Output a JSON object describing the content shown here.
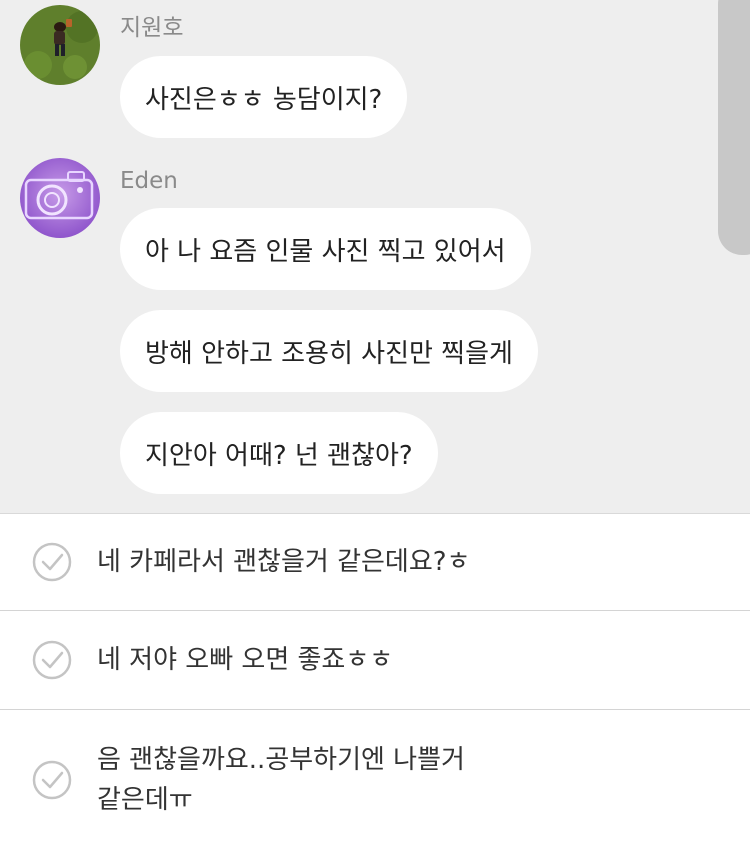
{
  "colors": {
    "chat_background": "#eeeeee",
    "bubble": "#ffffff",
    "sender_name": "#8a8a8a",
    "message_text": "#222222",
    "option_text": "#333333",
    "check_icon": "#c4c4c4",
    "scrollbar": "#c8c8c8"
  },
  "chat": {
    "messages": [
      {
        "sender": "지원호",
        "avatar_icon": "grass-photo-avatar",
        "bubbles": [
          "사진은ㅎㅎ 농담이지?"
        ]
      },
      {
        "sender": "Eden",
        "avatar_icon": "camera-photo-avatar",
        "bubbles": [
          "아 나 요즘 인물 사진 찍고 있어서",
          "방해 안하고 조용히 사진만 찍을게",
          "지안아 어때? 넌 괜찮아?"
        ]
      }
    ]
  },
  "options": [
    {
      "icon": "check-circle-icon",
      "text": "네 카페라서 괜찮을거 같은데요?ㅎ"
    },
    {
      "icon": "check-circle-icon",
      "text": "네 저야 오빠 오면 좋죠ㅎㅎ"
    },
    {
      "icon": "check-circle-icon",
      "text": "음 괜찮을까요..공부하기엔 나쁠거 같은데ㅠ"
    }
  ]
}
